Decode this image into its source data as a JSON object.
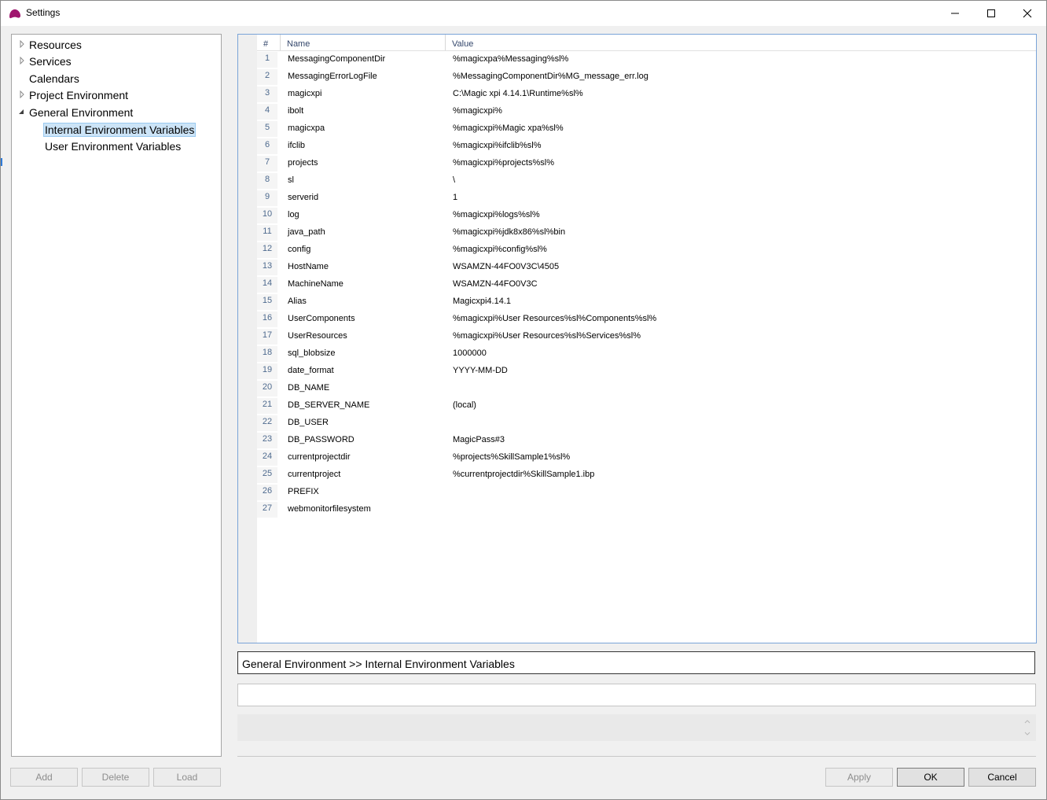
{
  "window": {
    "title": "Settings",
    "app_icon": "magic-xpi-icon"
  },
  "title_buttons": {
    "minimize": "minimize-icon",
    "maximize": "maximize-icon",
    "close": "close-icon"
  },
  "tree": {
    "items": [
      {
        "label": "Resources",
        "expandable": true,
        "expanded": false,
        "level": 0
      },
      {
        "label": "Services",
        "expandable": true,
        "expanded": false,
        "level": 0
      },
      {
        "label": "Calendars",
        "expandable": false,
        "level": 0
      },
      {
        "label": "Project Environment",
        "expandable": true,
        "expanded": false,
        "level": 0
      },
      {
        "label": "General Environment",
        "expandable": true,
        "expanded": true,
        "level": 0
      },
      {
        "label": "Internal Environment Variables",
        "expandable": false,
        "level": 1,
        "selected": true
      },
      {
        "label": "User Environment Variables",
        "expandable": false,
        "level": 1
      }
    ]
  },
  "grid": {
    "columns": {
      "num": "#",
      "name": "Name",
      "value": "Value"
    },
    "rows": [
      {
        "num": "1",
        "name": "MessagingComponentDir",
        "value": "%magicxpa%Messaging%sl%"
      },
      {
        "num": "2",
        "name": "MessagingErrorLogFile",
        "value": "%MessagingComponentDir%MG_message_err.log"
      },
      {
        "num": "3",
        "name": "magicxpi",
        "value": "C:\\Magic xpi 4.14.1\\Runtime%sl%"
      },
      {
        "num": "4",
        "name": "ibolt",
        "value": "%magicxpi%"
      },
      {
        "num": "5",
        "name": "magicxpa",
        "value": "%magicxpi%Magic xpa%sl%"
      },
      {
        "num": "6",
        "name": "ifclib",
        "value": "%magicxpi%ifclib%sl%"
      },
      {
        "num": "7",
        "name": "projects",
        "value": "%magicxpi%projects%sl%"
      },
      {
        "num": "8",
        "name": "sl",
        "value": "\\"
      },
      {
        "num": "9",
        "name": "serverid",
        "value": "1"
      },
      {
        "num": "10",
        "name": "log",
        "value": "%magicxpi%logs%sl%"
      },
      {
        "num": "11",
        "name": "java_path",
        "value": "%magicxpi%jdk8x86%sl%bin"
      },
      {
        "num": "12",
        "name": "config",
        "value": "%magicxpi%config%sl%"
      },
      {
        "num": "13",
        "name": "HostName",
        "value": "WSAMZN-44FO0V3C\\4505"
      },
      {
        "num": "14",
        "name": "MachineName",
        "value": "WSAMZN-44FO0V3C"
      },
      {
        "num": "15",
        "name": "Alias",
        "value": "Magicxpi4.14.1"
      },
      {
        "num": "16",
        "name": "UserComponents",
        "value": "%magicxpi%User Resources%sl%Components%sl%"
      },
      {
        "num": "17",
        "name": "UserResources",
        "value": "%magicxpi%User Resources%sl%Services%sl%"
      },
      {
        "num": "18",
        "name": "sql_blobsize",
        "value": "1000000"
      },
      {
        "num": "19",
        "name": "date_format",
        "value": "YYYY-MM-DD"
      },
      {
        "num": "20",
        "name": "DB_NAME",
        "value": ""
      },
      {
        "num": "21",
        "name": "DB_SERVER_NAME",
        "value": "(local)"
      },
      {
        "num": "22",
        "name": "DB_USER",
        "value": ""
      },
      {
        "num": "23",
        "name": "DB_PASSWORD",
        "value": "MagicPass#3"
      },
      {
        "num": "24",
        "name": "currentprojectdir",
        "value": "%projects%SkillSample1%sl%"
      },
      {
        "num": "25",
        "name": "currentproject",
        "value": "%currentprojectdir%SkillSample1.ibp"
      },
      {
        "num": "26",
        "name": "PREFIX",
        "value": ""
      },
      {
        "num": "27",
        "name": "webmonitorfilesystem",
        "value": ""
      }
    ]
  },
  "breadcrumb": "General Environment >> Internal Environment Variables",
  "description_input": {
    "value": ""
  },
  "buttons": {
    "add": "Add",
    "delete": "Delete",
    "load": "Load",
    "apply": "Apply",
    "ok": "OK",
    "cancel": "Cancel"
  },
  "colors": {
    "accent": "#2f7bd8",
    "selection": "#cce4f7",
    "app_icon": "#a0156e"
  }
}
